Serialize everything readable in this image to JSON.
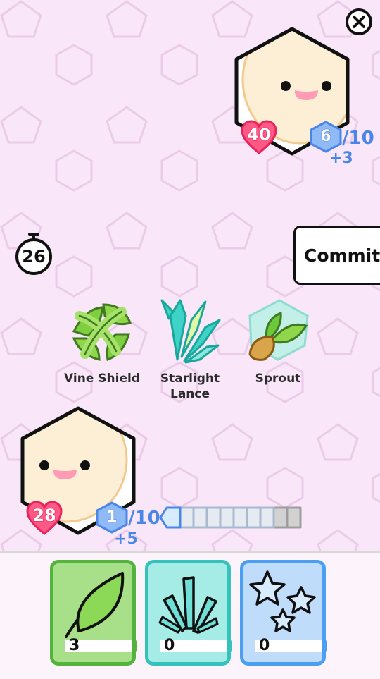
{
  "timer": {
    "seconds": "26"
  },
  "commit": {
    "label": "Commit"
  },
  "opponent": {
    "health": "40",
    "energy": "6",
    "energy_max": "/10",
    "energy_gain": "+3"
  },
  "player": {
    "health": "28",
    "energy": "1",
    "energy_max": "/10",
    "energy_gain": "+5",
    "energy_track": {
      "filled": 1,
      "segments": 10
    }
  },
  "cards": [
    {
      "name": "Vine Shield",
      "icon": "vine-shield-icon"
    },
    {
      "name": "Starlight Lance",
      "icon": "crystal-lance-icon"
    },
    {
      "name": "Sprout",
      "icon": "sprout-icon"
    }
  ],
  "resources": [
    {
      "type": "leaf",
      "icon": "leaf-icon",
      "count": "3",
      "color": "#53b33c"
    },
    {
      "type": "crystal",
      "icon": "crystal-icon",
      "count": "0",
      "color": "#34c2bd"
    },
    {
      "type": "star",
      "icon": "stars-icon",
      "count": "0",
      "color": "#4a9ff0"
    }
  ],
  "colors": {
    "background": "#f9e6f8",
    "health": "#e8245c",
    "energy": "#4a86e8"
  }
}
